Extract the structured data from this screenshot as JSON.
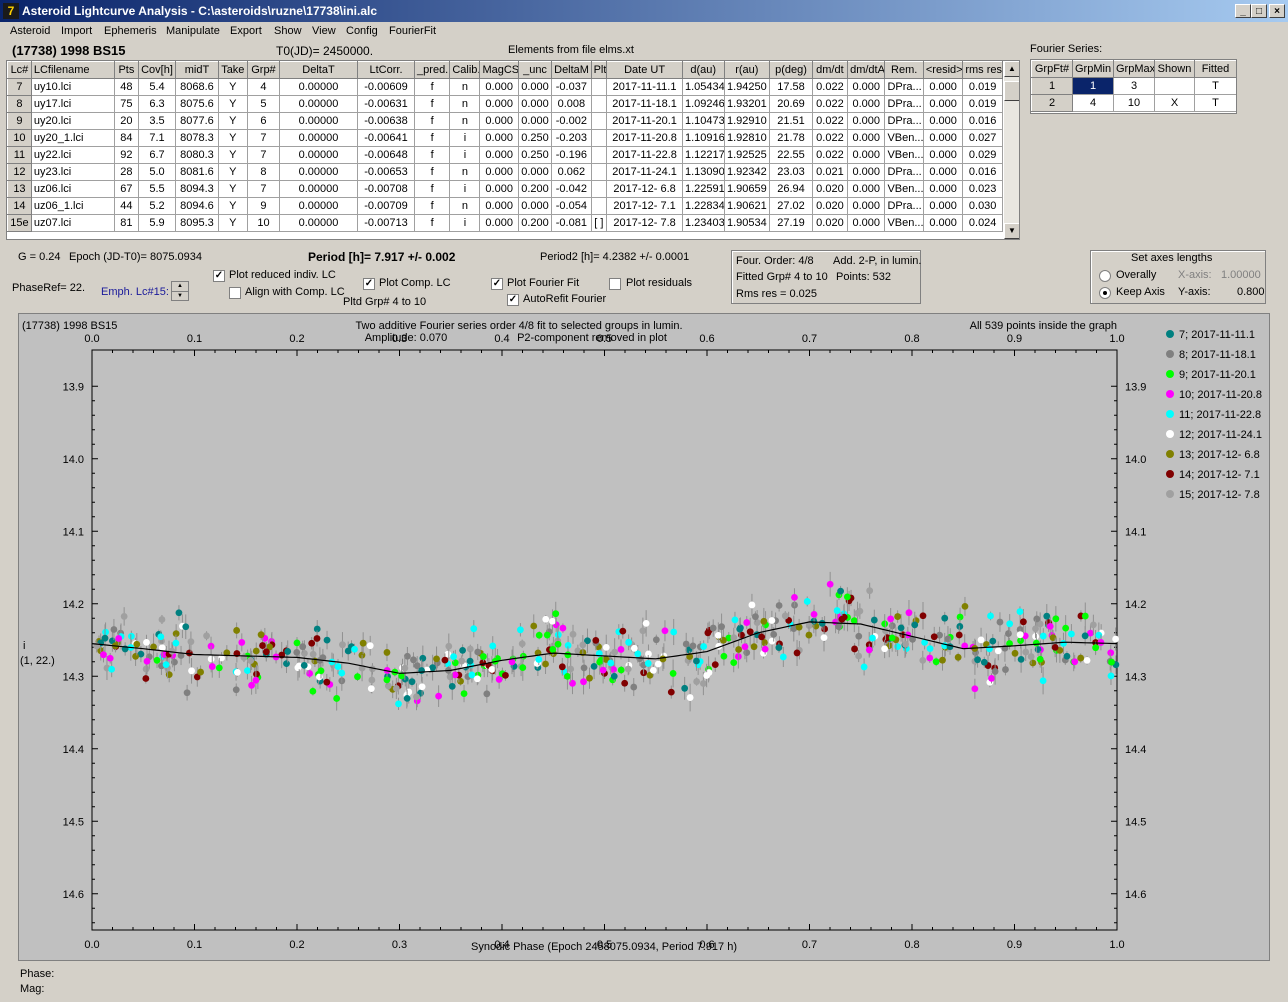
{
  "window": {
    "title": "Asteroid Lightcurve Analysis - C:\\asteroids\\ruzne\\17738\\ini.alc",
    "icon": "7"
  },
  "menu": [
    "Asteroid",
    "Import",
    "Ephemeris",
    "Manipulate",
    "Export",
    "Show",
    "View",
    "Config",
    "FourierFit"
  ],
  "header": {
    "asteroid": "(17738) 1998 BS15",
    "t0": "T0(JD)= 2450000.",
    "elements": "Elements from file elms.xt"
  },
  "table": {
    "columns": [
      "Lc#",
      "LCfilename",
      "Pts",
      "Cov[h]",
      "midT",
      "Take",
      "Grp#",
      "DeltaT",
      "LtCorr.",
      "_pred.",
      "Calib.",
      "MagCS",
      "_unc",
      "DeltaM",
      "Plt",
      "Date UT",
      "d(au)",
      "r(au)",
      "p(deg)",
      "dm/dt",
      "dm/dtA",
      "Rem.",
      "<resid>",
      "rms res"
    ],
    "rows": [
      [
        "7",
        "uy10.lci",
        "48",
        "5.4",
        "8068.6",
        "Y",
        "4",
        "0.00000",
        "-0.00609",
        "f",
        "n",
        "0.000",
        "0.000",
        "-0.037",
        "",
        "2017-11-11.1",
        "1.05434",
        "1.94250",
        "17.58",
        "0.022",
        "0.000",
        "DPra...",
        "0.000",
        "0.019"
      ],
      [
        "8",
        "uy17.lci",
        "75",
        "6.3",
        "8075.6",
        "Y",
        "5",
        "0.00000",
        "-0.00631",
        "f",
        "n",
        "0.000",
        "0.000",
        "0.008",
        "",
        "2017-11-18.1",
        "1.09246",
        "1.93201",
        "20.69",
        "0.022",
        "0.000",
        "DPra...",
        "0.000",
        "0.019"
      ],
      [
        "9",
        "uy20.lci",
        "20",
        "3.5",
        "8077.6",
        "Y",
        "6",
        "0.00000",
        "-0.00638",
        "f",
        "n",
        "0.000",
        "0.000",
        "-0.002",
        "",
        "2017-11-20.1",
        "1.10473",
        "1.92910",
        "21.51",
        "0.022",
        "0.000",
        "DPra...",
        "0.000",
        "0.016"
      ],
      [
        "10",
        "uy20_1.lci",
        "84",
        "7.1",
        "8078.3",
        "Y",
        "7",
        "0.00000",
        "-0.00641",
        "f",
        "i",
        "0.000",
        "0.250",
        "-0.203",
        "",
        "2017-11-20.8",
        "1.10916",
        "1.92810",
        "21.78",
        "0.022",
        "0.000",
        "VBen...",
        "0.000",
        "0.027"
      ],
      [
        "11",
        "uy22.lci",
        "92",
        "6.7",
        "8080.3",
        "Y",
        "7",
        "0.00000",
        "-0.00648",
        "f",
        "i",
        "0.000",
        "0.250",
        "-0.196",
        "",
        "2017-11-22.8",
        "1.12217",
        "1.92525",
        "22.55",
        "0.022",
        "0.000",
        "VBen...",
        "0.000",
        "0.029"
      ],
      [
        "12",
        "uy23.lci",
        "28",
        "5.0",
        "8081.6",
        "Y",
        "8",
        "0.00000",
        "-0.00653",
        "f",
        "n",
        "0.000",
        "0.000",
        "0.062",
        "",
        "2017-11-24.1",
        "1.13090",
        "1.92342",
        "23.03",
        "0.021",
        "0.000",
        "DPra...",
        "0.000",
        "0.016"
      ],
      [
        "13",
        "uz06.lci",
        "67",
        "5.5",
        "8094.3",
        "Y",
        "7",
        "0.00000",
        "-0.00708",
        "f",
        "i",
        "0.000",
        "0.200",
        "-0.042",
        "",
        "2017-12- 6.8",
        "1.22591",
        "1.90659",
        "26.94",
        "0.020",
        "0.000",
        "VBen...",
        "0.000",
        "0.023"
      ],
      [
        "14",
        "uz06_1.lci",
        "44",
        "5.2",
        "8094.6",
        "Y",
        "9",
        "0.00000",
        "-0.00709",
        "f",
        "n",
        "0.000",
        "0.000",
        "-0.054",
        "",
        "2017-12- 7.1",
        "1.22834",
        "1.90621",
        "27.02",
        "0.020",
        "0.000",
        "DPra...",
        "0.000",
        "0.030"
      ],
      [
        "15e",
        "uz07.lci",
        "81",
        "5.9",
        "8095.3",
        "Y",
        "10",
        "0.00000",
        "-0.00713",
        "f",
        "i",
        "0.000",
        "0.200",
        "-0.081",
        "[ ]",
        "2017-12- 7.8",
        "1.23403",
        "1.90534",
        "27.19",
        "0.020",
        "0.000",
        "VBen...",
        "0.000",
        "0.024"
      ]
    ]
  },
  "fourier": {
    "title": "Fourier Series:",
    "columns": [
      "GrpFt#",
      "GrpMin",
      "GrpMax",
      "Shown",
      "Fitted"
    ],
    "rows": [
      [
        "1",
        "1",
        "3",
        "",
        "T"
      ],
      [
        "2",
        "4",
        "10",
        "X",
        "T"
      ]
    ]
  },
  "info": {
    "g": "G = 0.24",
    "epoch": "Epoch (JD-T0)= 8075.0934",
    "period": "Period [h]= 7.917 +/- 0.002",
    "period2": "Period2 [h]= 4.2382 +/- 0.0001",
    "phaseref": "PhaseRef= 22.",
    "emph": "Emph. Lc#15:",
    "pltd": "Pltd Grp#  4   to   10"
  },
  "checks": {
    "reduced": {
      "label": "Plot reduced indiv. LC",
      "checked": true
    },
    "align": {
      "label": "Align with Comp. LC",
      "checked": false
    },
    "comp": {
      "label": "Plot Comp. LC",
      "checked": true
    },
    "fourier": {
      "label": "Plot Fourier Fit",
      "checked": true
    },
    "autorefit": {
      "label": "AutoRefit Fourier",
      "checked": true
    },
    "residuals": {
      "label": "Plot residuals",
      "checked": false
    }
  },
  "fitinfo": {
    "order": "Four. Order:  4/8",
    "add": "Add. 2-P, in lumin.",
    "fitted": "Fitted Grp# 4 to 10",
    "points": "Points: 532",
    "rms": "Rms res      = 0.025"
  },
  "axes": {
    "title": "Set axes lengths",
    "overally": "Overally",
    "keep": "Keep Axis",
    "xaxis": "X-axis:",
    "xval": "1.00000",
    "yaxis": "Y-axis:",
    "yval": "0.800"
  },
  "chart_data": {
    "type": "scatter",
    "title_left": "(17738) 1998 BS15",
    "title": "Two additive Fourier series order 4/8 fit to selected groups in lumin.",
    "subtitle_a": "Amplitude: 0.070",
    "subtitle_b": "P2-component removed in plot",
    "note": "All 539 points inside the graph",
    "xlabel": "Synodic Phase (Epoch 2458075.0934, Period 7.917 h)",
    "ylabel": "i",
    "ylabel2": "(1, 22.)",
    "xlim": [
      0,
      1
    ],
    "ylim": [
      13.85,
      14.65
    ],
    "y_reversed": true,
    "xticks": [
      "0.0",
      "0.1",
      "0.2",
      "0.3",
      "0.4",
      "0.5",
      "0.6",
      "0.7",
      "0.8",
      "0.9",
      "1.0"
    ],
    "yticks": [
      "13.9",
      "14.0",
      "14.1",
      "14.2",
      "14.3",
      "14.4",
      "14.5",
      "14.6"
    ],
    "fit_curve": {
      "x": [
        0.0,
        0.05,
        0.1,
        0.15,
        0.2,
        0.25,
        0.3,
        0.35,
        0.4,
        0.45,
        0.5,
        0.55,
        0.6,
        0.65,
        0.7,
        0.75,
        0.8,
        0.85,
        0.9,
        0.95,
        1.0
      ],
      "y": [
        14.255,
        14.262,
        14.27,
        14.272,
        14.274,
        14.282,
        14.296,
        14.292,
        14.278,
        14.268,
        14.272,
        14.276,
        14.266,
        14.24,
        14.225,
        14.228,
        14.245,
        14.262,
        14.258,
        14.253,
        14.255
      ]
    },
    "series": [
      {
        "name": "7; 2017-11-11.1",
        "color": "#008080"
      },
      {
        "name": "8; 2017-11-18.1",
        "color": "#808080"
      },
      {
        "name": "9; 2017-11-20.1",
        "color": "#00ff00"
      },
      {
        "name": "10; 2017-11-20.8",
        "color": "#ff00ff"
      },
      {
        "name": "11; 2017-11-22.8",
        "color": "#00ffff"
      },
      {
        "name": "12; 2017-11-24.1",
        "color": "#ffffff"
      },
      {
        "name": "13; 2017-12- 6.8",
        "color": "#808000"
      },
      {
        "name": "14; 2017-12- 7.1",
        "color": "#800000"
      },
      {
        "name": "15; 2017-12- 7.8",
        "color": "#a0a0a0"
      }
    ]
  },
  "status": {
    "phase": "Phase:",
    "mag": "Mag:"
  }
}
